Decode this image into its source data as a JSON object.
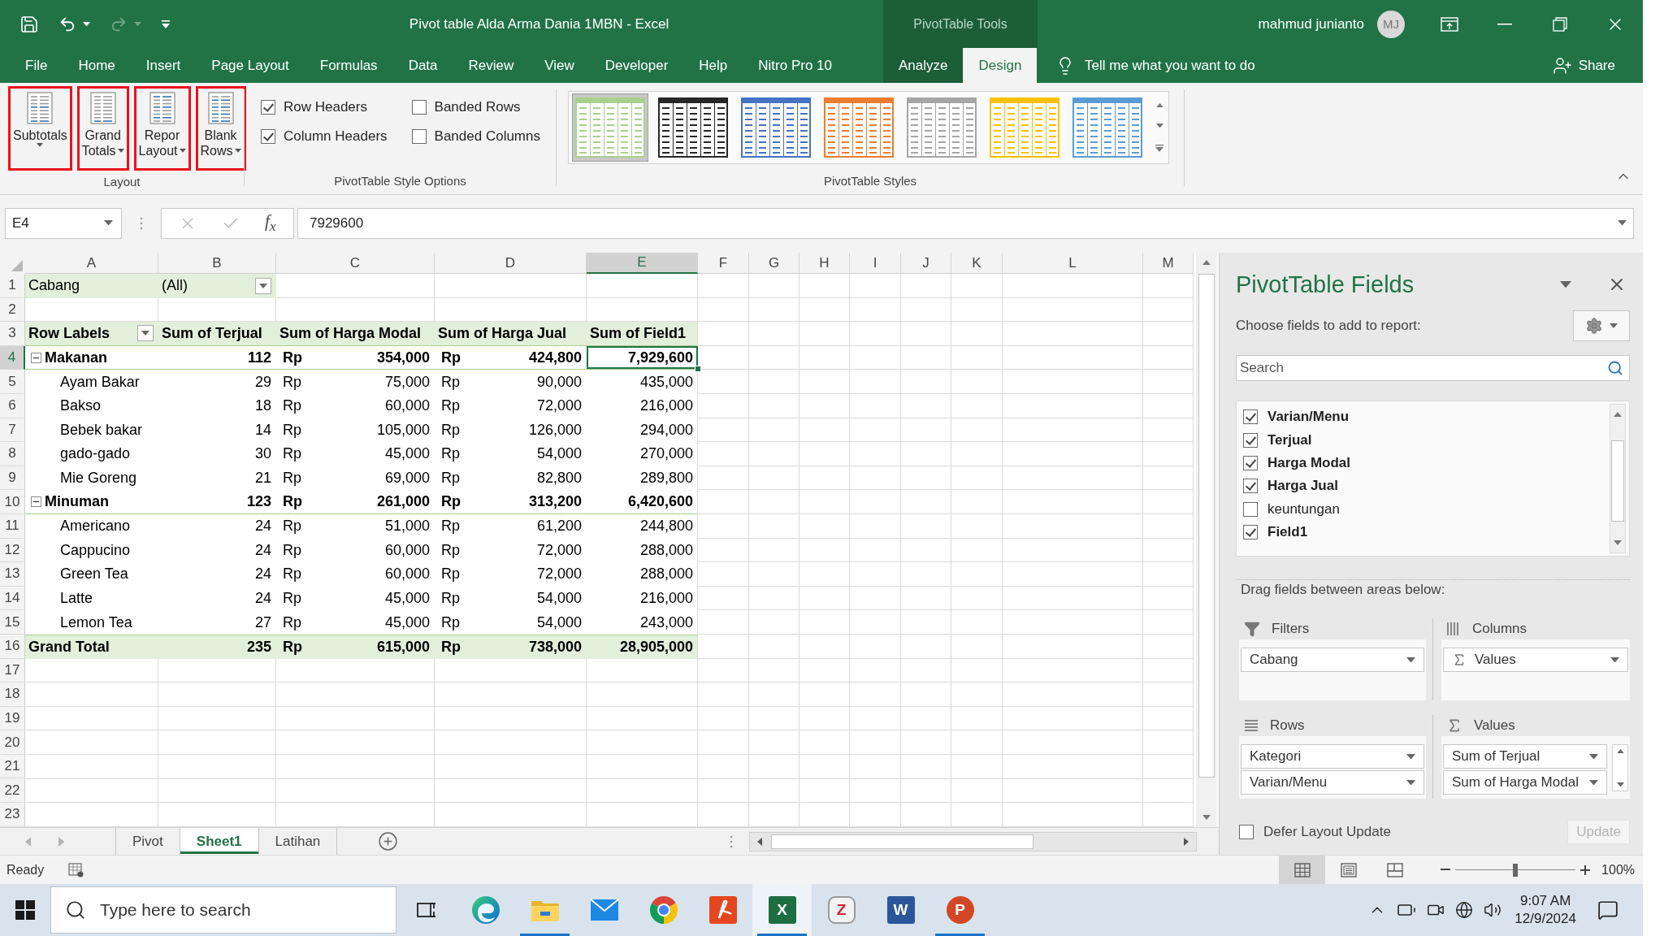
{
  "title_bar": {
    "title": "Pivot table Alda Arma Dania 1MBN - Excel",
    "context_label": "PivotTable Tools",
    "user_name": "mahmud junianto",
    "user_initials": "MJ",
    "redo_disabled": true
  },
  "ribbon_tabs": [
    {
      "label": "File",
      "selected": false,
      "contextual": false
    },
    {
      "label": "Home",
      "selected": false,
      "contextual": false
    },
    {
      "label": "Insert",
      "selected": false,
      "contextual": false
    },
    {
      "label": "Page Layout",
      "selected": false,
      "contextual": false
    },
    {
      "label": "Formulas",
      "selected": false,
      "contextual": false
    },
    {
      "label": "Data",
      "selected": false,
      "contextual": false
    },
    {
      "label": "Review",
      "selected": false,
      "contextual": false
    },
    {
      "label": "View",
      "selected": false,
      "contextual": false
    },
    {
      "label": "Developer",
      "selected": false,
      "contextual": false
    },
    {
      "label": "Help",
      "selected": false,
      "contextual": false
    },
    {
      "label": "Nitro Pro 10",
      "selected": false,
      "contextual": false
    },
    {
      "label": "Analyze",
      "selected": false,
      "contextual": true
    },
    {
      "label": "Design",
      "selected": true,
      "contextual": true
    }
  ],
  "tell_me": "Tell me what you want to do",
  "share": "Share",
  "ribbon": {
    "layout": {
      "label": "Layout",
      "buttons": [
        {
          "lines": [
            "Subtotals"
          ],
          "highlighted": true
        },
        {
          "lines": [
            "Grand",
            "Totals"
          ],
          "highlighted": true
        },
        {
          "lines": [
            "Repor",
            "Layout"
          ],
          "highlighted": true
        },
        {
          "lines": [
            "Blank",
            "Rows"
          ],
          "highlighted": true
        }
      ]
    },
    "style_options": {
      "label": "PivotTable Style Options",
      "options": [
        {
          "label": "Row Headers",
          "checked": true
        },
        {
          "label": "Banded Rows",
          "checked": false
        },
        {
          "label": "Column Headers",
          "checked": true
        },
        {
          "label": "Banded Columns",
          "checked": false
        }
      ]
    },
    "styles": {
      "label": "PivotTable Styles",
      "items": [
        {
          "color": "#a9d08e",
          "selected": true
        },
        {
          "color": "#262626",
          "selected": false
        },
        {
          "color": "#4472c4",
          "selected": false
        },
        {
          "color": "#ed7d31",
          "selected": false
        },
        {
          "color": "#a5a5a5",
          "selected": false
        },
        {
          "color": "#ffc000",
          "selected": false
        },
        {
          "color": "#5b9bd5",
          "selected": false
        }
      ]
    }
  },
  "formula_bar": {
    "name_box": "E4",
    "function_label": "f$_{x}$",
    "value": "7929600"
  },
  "sheet": {
    "columns": [
      {
        "label": "A",
        "selected": false
      },
      {
        "label": "B",
        "selected": false
      },
      {
        "label": "C",
        "selected": false
      },
      {
        "label": "D",
        "selected": false
      },
      {
        "label": "E",
        "selected": true
      },
      {
        "label": "F",
        "selected": false
      },
      {
        "label": "G",
        "selected": false
      },
      {
        "label": "H",
        "selected": false
      },
      {
        "label": "I",
        "selected": false
      },
      {
        "label": "J",
        "selected": false
      },
      {
        "label": "K",
        "selected": false
      },
      {
        "label": "L",
        "selected": false
      },
      {
        "label": "M",
        "selected": false
      }
    ],
    "rows": [
      {
        "label": "1",
        "selected": false
      },
      {
        "label": "2",
        "selected": false
      },
      {
        "label": "3",
        "selected": false
      },
      {
        "label": "4",
        "selected": true
      },
      {
        "label": "5",
        "selected": false
      },
      {
        "label": "6",
        "selected": false
      },
      {
        "label": "7",
        "selected": false
      },
      {
        "label": "8",
        "selected": false
      },
      {
        "label": "9",
        "selected": false
      },
      {
        "label": "10",
        "selected": false
      },
      {
        "label": "11",
        "selected": false
      },
      {
        "label": "12",
        "selected": false
      },
      {
        "label": "13",
        "selected": false
      },
      {
        "label": "14",
        "selected": false
      },
      {
        "label": "15",
        "selected": false
      },
      {
        "label": "16",
        "selected": false
      },
      {
        "label": "17",
        "selected": false
      },
      {
        "label": "18",
        "selected": false
      },
      {
        "label": "19",
        "selected": false
      },
      {
        "label": "20",
        "selected": false
      },
      {
        "label": "21",
        "selected": false
      },
      {
        "label": "22",
        "selected": false
      },
      {
        "label": "23",
        "selected": false
      }
    ]
  },
  "pivot": {
    "filter": {
      "field": "Cabang",
      "value": "(All)"
    },
    "headers": [
      "Row Labels",
      "Sum of Terjual",
      "Sum of Harga Modal",
      "Sum of Harga Jual",
      "Sum of Field1"
    ],
    "rows": [
      {
        "kind": "group",
        "label": "Makanan",
        "expanded": true,
        "terjual": "112",
        "modal_currency": "Rp",
        "modal": "354,000",
        "jual_currency": "Rp",
        "jual": "424,800",
        "field1": "7,929,600",
        "children": [
          {
            "label": "Ayam Bakar",
            "terjual": "29",
            "modal_currency": "Rp",
            "modal": "75,000",
            "jual_currency": "Rp",
            "jual": "90,000",
            "field1": "435,000"
          },
          {
            "label": "Bakso",
            "terjual": "18",
            "modal_currency": "Rp",
            "modal": "60,000",
            "jual_currency": "Rp",
            "jual": "72,000",
            "field1": "216,000"
          },
          {
            "label": "Bebek bakar",
            "terjual": "14",
            "modal_currency": "Rp",
            "modal": "105,000",
            "jual_currency": "Rp",
            "jual": "126,000",
            "field1": "294,000"
          },
          {
            "label": "gado-gado",
            "terjual": "30",
            "modal_currency": "Rp",
            "modal": "45,000",
            "jual_currency": "Rp",
            "jual": "54,000",
            "field1": "270,000"
          },
          {
            "label": "Mie Goreng",
            "terjual": "21",
            "modal_currency": "Rp",
            "modal": "69,000",
            "jual_currency": "Rp",
            "jual": "82,800",
            "field1": "289,800"
          }
        ]
      },
      {
        "kind": "group",
        "label": "Minuman",
        "expanded": true,
        "terjual": "123",
        "modal_currency": "Rp",
        "modal": "261,000",
        "jual_currency": "Rp",
        "jual": "313,200",
        "field1": "6,420,600",
        "children": [
          {
            "label": "Americano",
            "terjual": "24",
            "modal_currency": "Rp",
            "modal": "51,000",
            "jual_currency": "Rp",
            "jual": "61,200",
            "field1": "244,800"
          },
          {
            "label": "Cappucino",
            "terjual": "24",
            "modal_currency": "Rp",
            "modal": "60,000",
            "jual_currency": "Rp",
            "jual": "72,000",
            "field1": "288,000"
          },
          {
            "label": "Green Tea",
            "terjual": "24",
            "modal_currency": "Rp",
            "modal": "60,000",
            "jual_currency": "Rp",
            "jual": "72,000",
            "field1": "288,000"
          },
          {
            "label": "Latte",
            "terjual": "24",
            "modal_currency": "Rp",
            "modal": "45,000",
            "jual_currency": "Rp",
            "jual": "54,000",
            "field1": "216,000"
          },
          {
            "label": "Lemon Tea",
            "terjual": "27",
            "modal_currency": "Rp",
            "modal": "45,000",
            "jual_currency": "Rp",
            "jual": "54,000",
            "field1": "243,000"
          }
        ]
      },
      {
        "kind": "total",
        "label": "Grand Total",
        "terjual": "235",
        "modal_currency": "Rp",
        "modal": "615,000",
        "jual_currency": "Rp",
        "jual": "738,000",
        "field1": "28,905,000"
      }
    ]
  },
  "sheet_tabs": [
    {
      "label": "Pivot",
      "selected": false
    },
    {
      "label": "Sheet1",
      "selected": true
    },
    {
      "label": "Latihan",
      "selected": false
    }
  ],
  "status_bar": {
    "status": "Ready",
    "views": [
      {
        "kind": "normal",
        "selected": true
      },
      {
        "kind": "page_layout",
        "selected": false
      },
      {
        "kind": "page_break",
        "selected": false
      }
    ],
    "zoom": {
      "level": 0.5,
      "reading": "100%"
    }
  },
  "pivot_fields": {
    "title": "PivotTable Fields",
    "subtitle": "Choose fields to add to report:",
    "search_placeholder": "Search",
    "fields": [
      {
        "label": "Varian/Menu",
        "checked": true
      },
      {
        "label": "Terjual",
        "checked": true
      },
      {
        "label": "Harga Modal",
        "checked": true
      },
      {
        "label": "Harga Jual",
        "checked": true
      },
      {
        "label": "keuntungan",
        "checked": false
      },
      {
        "label": "Field1",
        "checked": true
      }
    ],
    "areas_hint": "Drag fields between areas below:",
    "areas": [
      {
        "kind": "filters",
        "label": "Filters",
        "items": [
          {
            "label": "Cabang"
          }
        ]
      },
      {
        "kind": "columns",
        "label": "Columns",
        "items": [
          {
            "label": "Values",
            "sigma": true
          }
        ]
      },
      {
        "kind": "rows",
        "label": "Rows",
        "items": [
          {
            "label": "Kategori"
          },
          {
            "label": "Varian/Menu"
          }
        ]
      },
      {
        "kind": "values",
        "label": "Values",
        "items": [
          {
            "label": "Sum of Terjual"
          },
          {
            "label": "Sum of Harga Modal"
          }
        ]
      }
    ],
    "defer": {
      "label": "Defer Layout Update",
      "checked": false
    },
    "update": {
      "label": "Update",
      "disabled": true
    }
  },
  "taskbar": {
    "search_placeholder": "Type here to search",
    "apps": [
      {
        "kind": "task_view",
        "running": false,
        "active": false
      },
      {
        "kind": "edge",
        "running": false,
        "active": false
      },
      {
        "kind": "explorer",
        "running": true,
        "active": false
      },
      {
        "kind": "mail",
        "running": false,
        "active": false
      },
      {
        "kind": "chrome",
        "running": false,
        "active": false
      },
      {
        "kind": "acrobat",
        "running": false,
        "active": false
      },
      {
        "kind": "excel",
        "letter": "X",
        "running": true,
        "active": true
      },
      {
        "kind": "zotero",
        "letter": "Z",
        "running": false,
        "active": false
      },
      {
        "kind": "word",
        "letter": "W",
        "running": false,
        "active": false
      },
      {
        "kind": "powerpoint",
        "letter": "P",
        "running": true,
        "active": false
      }
    ],
    "time": "9:07 AM",
    "date": "12/9/2024"
  }
}
